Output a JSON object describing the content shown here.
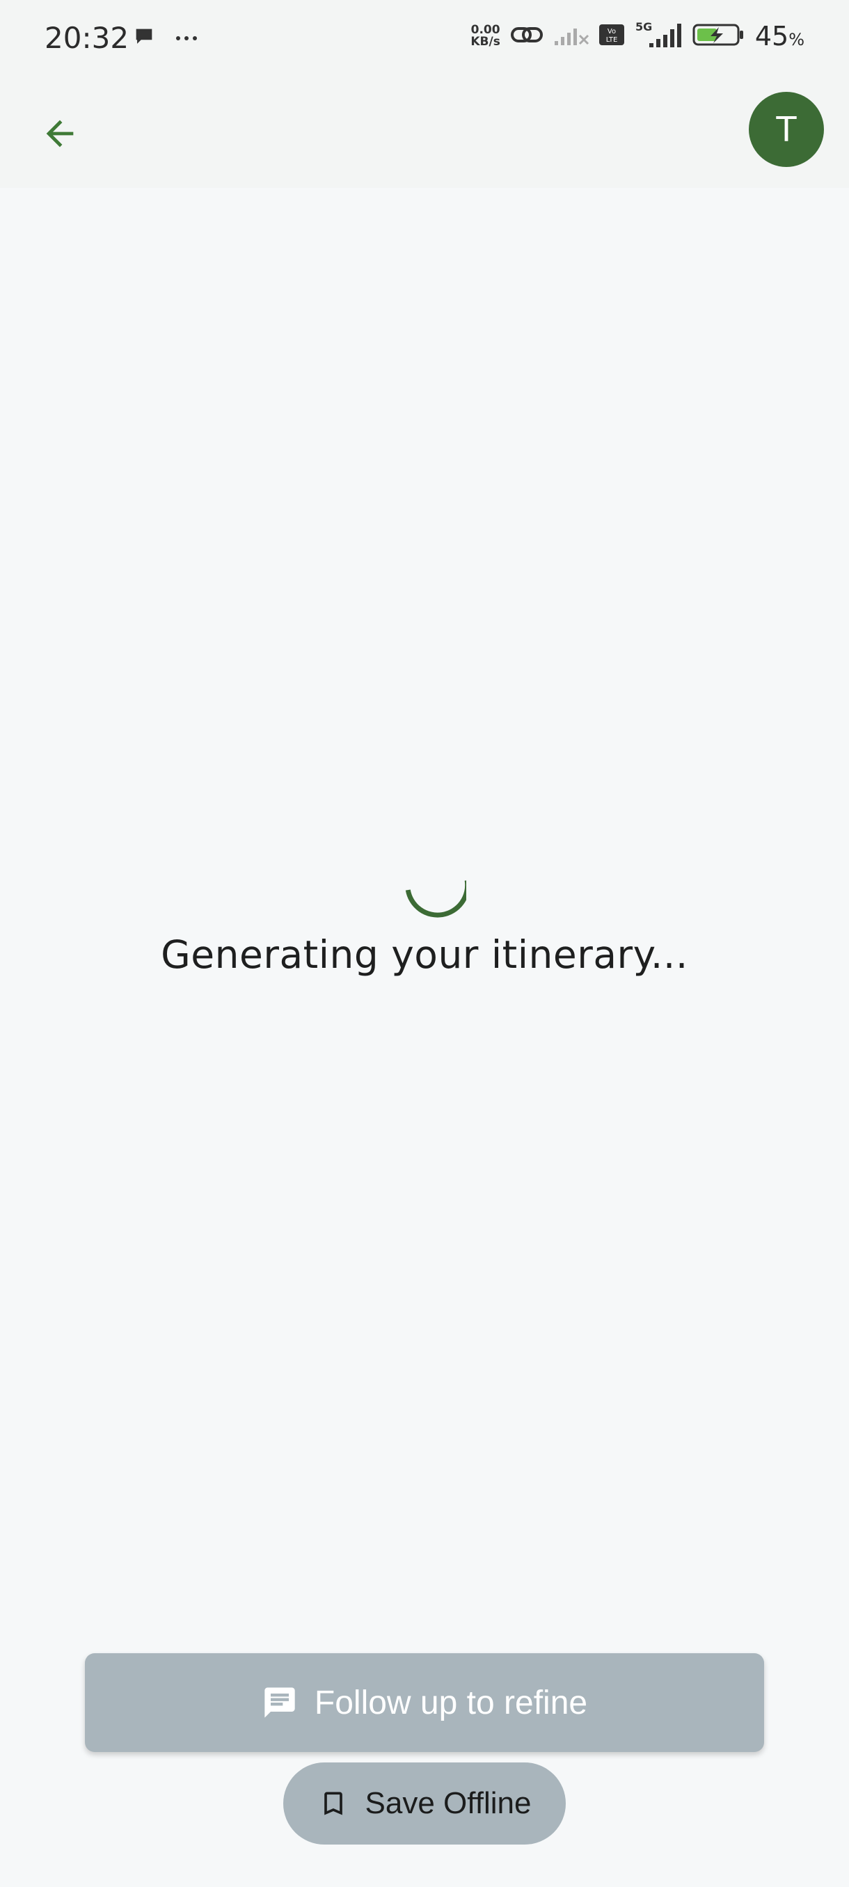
{
  "status_bar": {
    "time": "20:32",
    "net_speed_value": "0.00",
    "net_speed_unit": "KB/s",
    "network_label": "5G",
    "volte_label": "Vo LTE",
    "battery_percent": "45",
    "battery_unit": "%",
    "icons": [
      "chat-bubble-icon",
      "more-dots-icon",
      "link-icon",
      "signal-off-icon",
      "volte-icon",
      "signal-icon",
      "battery-charging-icon"
    ]
  },
  "app_bar": {
    "back_icon": "arrow-left-icon",
    "avatar_initial": "T"
  },
  "main": {
    "loading_text": "Generating your itinerary..."
  },
  "actions": {
    "follow_up_label": "Follow up to refine",
    "follow_up_icon": "message-icon",
    "save_offline_label": "Save Offline",
    "save_offline_icon": "bookmark-icon"
  },
  "colors": {
    "accent": "#3c6b35",
    "button_disabled": "#a9b5bc",
    "background": "#f6f8f9"
  }
}
